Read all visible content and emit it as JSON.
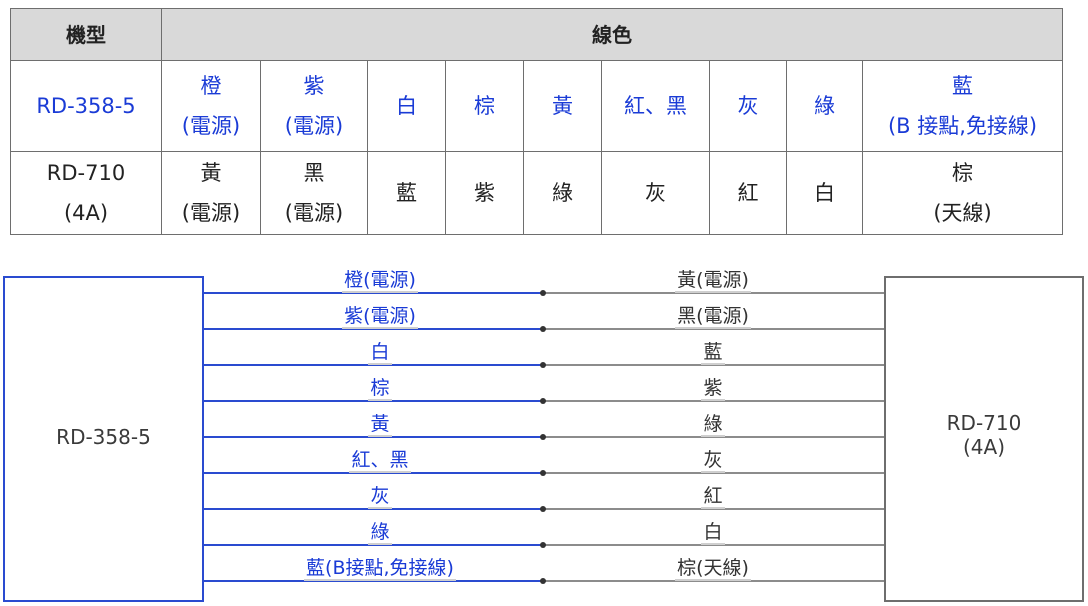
{
  "table": {
    "header": {
      "model": "機型",
      "wire_color": "線色"
    },
    "rows": [
      {
        "model": [
          "RD-358-5"
        ],
        "cells": [
          [
            "橙",
            "(電源)"
          ],
          [
            "紫",
            "(電源)"
          ],
          [
            "白"
          ],
          [
            "棕"
          ],
          [
            "黃"
          ],
          [
            "紅、黑"
          ],
          [
            "灰"
          ],
          [
            "綠"
          ],
          [
            "藍",
            "(B 接點,免接線)"
          ]
        ]
      },
      {
        "model": [
          "RD-710",
          "(4A)"
        ],
        "cells": [
          [
            "黃",
            "(電源)"
          ],
          [
            "黑",
            "(電源)"
          ],
          [
            "藍"
          ],
          [
            "紫"
          ],
          [
            "綠"
          ],
          [
            "灰"
          ],
          [
            "紅"
          ],
          [
            "白"
          ],
          [
            "棕",
            "(天線)"
          ]
        ]
      }
    ]
  },
  "diagram": {
    "left_device": "RD-358-5",
    "right_device": [
      "RD-710",
      "(4A)"
    ],
    "wires": [
      {
        "left": "橙(電源)",
        "right": "黃(電源)"
      },
      {
        "left": "紫(電源)",
        "right": "黑(電源)"
      },
      {
        "left": "白",
        "right": "藍"
      },
      {
        "left": "棕",
        "right": "紫"
      },
      {
        "left": "黃",
        "right": "綠"
      },
      {
        "left": "紅、黑",
        "right": "灰"
      },
      {
        "left": "灰",
        "right": "紅"
      },
      {
        "left": "綠",
        "right": "白"
      },
      {
        "left": "藍(B接點,免接線)",
        "right": "棕(天線)"
      }
    ]
  },
  "colors": {
    "left_accent": "#1a3bd6",
    "right_text": "#222222",
    "header_bg": "#d9d9d9"
  }
}
